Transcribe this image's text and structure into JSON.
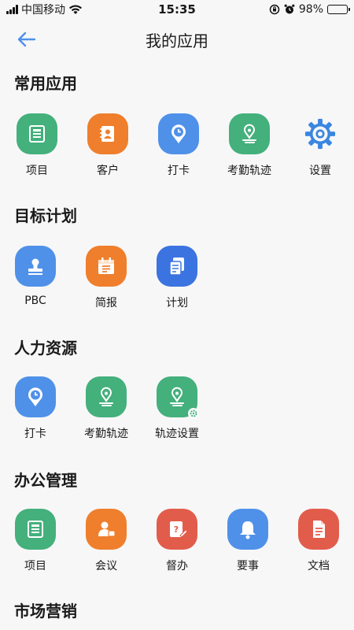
{
  "status_bar": {
    "carrier": "中国移动",
    "time": "15:35",
    "battery": "98%"
  },
  "header": {
    "title": "我的应用"
  },
  "sections": [
    {
      "title": "常用应用",
      "apps": [
        {
          "label": "项目",
          "icon": "project-icon",
          "color": "#44b07c"
        },
        {
          "label": "客户",
          "icon": "customer-icon",
          "color": "#ef7f2c"
        },
        {
          "label": "打卡",
          "icon": "clock-in-icon",
          "color": "#4f91e9"
        },
        {
          "label": "考勤轨迹",
          "icon": "attendance-track-icon",
          "color": "#44b07c"
        },
        {
          "label": "设置",
          "icon": "settings-gear-icon",
          "color": "#3a86e0"
        }
      ]
    },
    {
      "title": "目标计划",
      "apps": [
        {
          "label": "PBC",
          "icon": "stamp-icon",
          "color": "#4f91e9"
        },
        {
          "label": "简报",
          "icon": "briefing-calendar-icon",
          "color": "#ef7f2c"
        },
        {
          "label": "计划",
          "icon": "plan-documents-icon",
          "color": "#3b74e0"
        }
      ]
    },
    {
      "title": "人力资源",
      "apps": [
        {
          "label": "打卡",
          "icon": "clock-in-icon",
          "color": "#4f91e9"
        },
        {
          "label": "考勤轨迹",
          "icon": "attendance-track-icon",
          "color": "#44b07c"
        },
        {
          "label": "轨迹设置",
          "icon": "track-settings-icon",
          "color": "#44b07c"
        }
      ]
    },
    {
      "title": "办公管理",
      "apps": [
        {
          "label": "项目",
          "icon": "project-icon",
          "color": "#44b07c"
        },
        {
          "label": "会议",
          "icon": "meeting-icon",
          "color": "#ef7f2c"
        },
        {
          "label": "督办",
          "icon": "supervise-icon",
          "color": "#e25c4b"
        },
        {
          "label": "要事",
          "icon": "bell-icon",
          "color": "#4f91e9"
        },
        {
          "label": "文档",
          "icon": "document-icon",
          "color": "#e25c4b"
        }
      ]
    },
    {
      "title": "市场营销",
      "apps": []
    }
  ]
}
